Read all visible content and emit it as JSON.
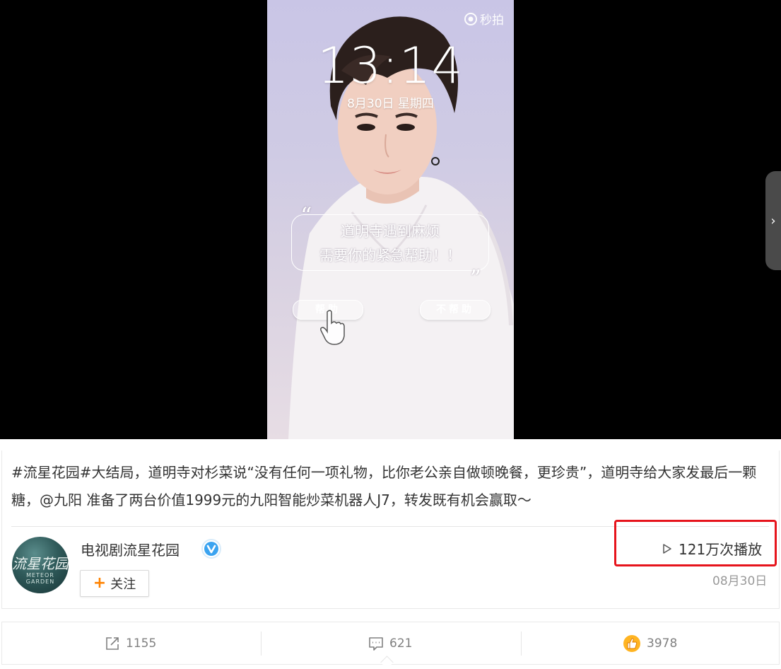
{
  "video": {
    "watermark": "秒拍",
    "lock_time": "13:14",
    "lock_date": "8月30日  星期四",
    "bubble_line1": "道明寺遇到麻烦",
    "bubble_line2": "需要你的紧急帮助！！",
    "quote_open": "“",
    "quote_close": "”",
    "help_button": "帮助",
    "no_help_button": "不帮助",
    "next_arrow": "›"
  },
  "post": {
    "text": "#流星花园#大结局，道明寺对杉菜说“没有任何一项礼物，比你老公亲自做顿晚餐，更珍贵”，道明寺给大家发最后一颗糖，@九阳 准备了两台价值1999元的九阳智能炒菜机器人J7，转发既有机会赢取～",
    "account_name": "电视剧流星花园",
    "avatar_text": "流星花园",
    "avatar_sub": "METEOR GARDEN",
    "follow_label": "关注",
    "follow_plus": "+",
    "play_count": "121万次播放",
    "date": "08月30日"
  },
  "actions": {
    "repost_count": "1155",
    "comment_count": "621",
    "like_count": "3978"
  },
  "colors": {
    "accent_orange": "#ff8200",
    "highlight_red": "#e6141c",
    "verify_blue": "#3aa3f0"
  }
}
